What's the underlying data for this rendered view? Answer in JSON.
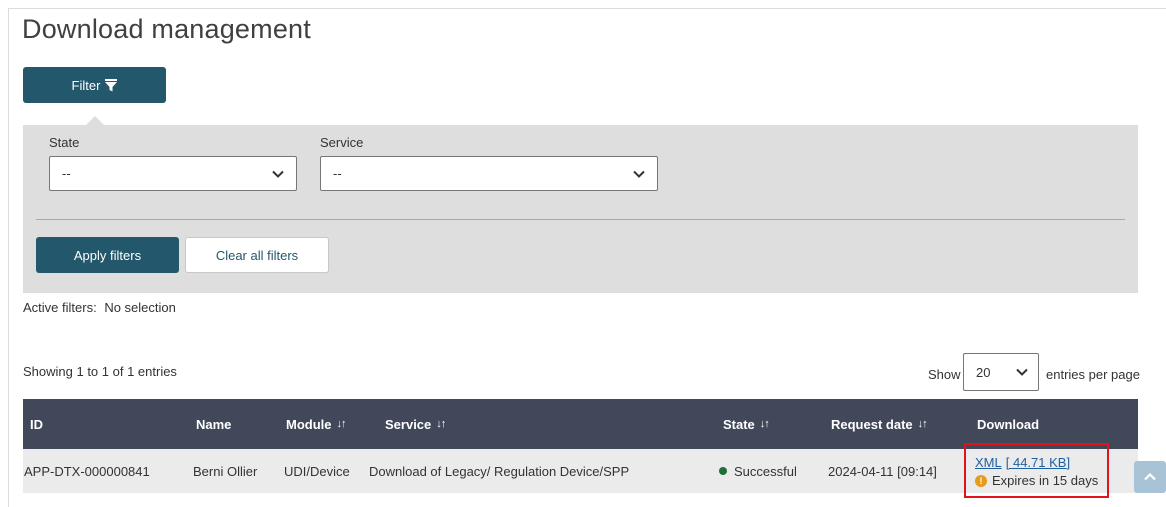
{
  "page": {
    "title": "Download management"
  },
  "filter": {
    "toggle_label": "Filter",
    "fields": [
      {
        "label": "State",
        "value": "--"
      },
      {
        "label": "Service",
        "value": "--"
      }
    ],
    "apply_label": "Apply filters",
    "clear_label": "Clear all filters"
  },
  "active_filters": {
    "label": "Active filters:",
    "value": "No selection"
  },
  "table_info": {
    "showing": "Showing 1 to 1 of 1 entries",
    "show_label": "Show",
    "per_page_value": "20",
    "per_page_label": "entries per page"
  },
  "table": {
    "columns": [
      {
        "label": "ID",
        "sortable": false
      },
      {
        "label": "Name",
        "sortable": false
      },
      {
        "label": "Module",
        "sortable": true
      },
      {
        "label": "Service",
        "sortable": true
      },
      {
        "label": "State",
        "sortable": true
      },
      {
        "label": "Request date",
        "sortable": true
      },
      {
        "label": "Download",
        "sortable": false
      }
    ],
    "sort_glyph": "↓↑",
    "rows": [
      {
        "id": "APP-DTX-000000841",
        "name": "Berni Ollier",
        "module": "UDI/Device",
        "service": "Download of Legacy/ Regulation Device/SPP",
        "state": "Successful",
        "state_color": "#1f6e3a",
        "request_date": "2024-04-11 [09:14]",
        "download_format": "XML",
        "download_size": "[ 44.71 KB]",
        "expires": "Expires in 15 days"
      }
    ]
  },
  "colors": {
    "primary": "#23576b",
    "table_header": "#404859",
    "highlight_border": "#e0151b",
    "warning": "#e89a1c"
  },
  "icons": {
    "filter": "funnel-icon",
    "select": "chevron-down-icon",
    "warning": "exclamation-circle-icon",
    "scroll_top": "chevron-up-icon"
  }
}
